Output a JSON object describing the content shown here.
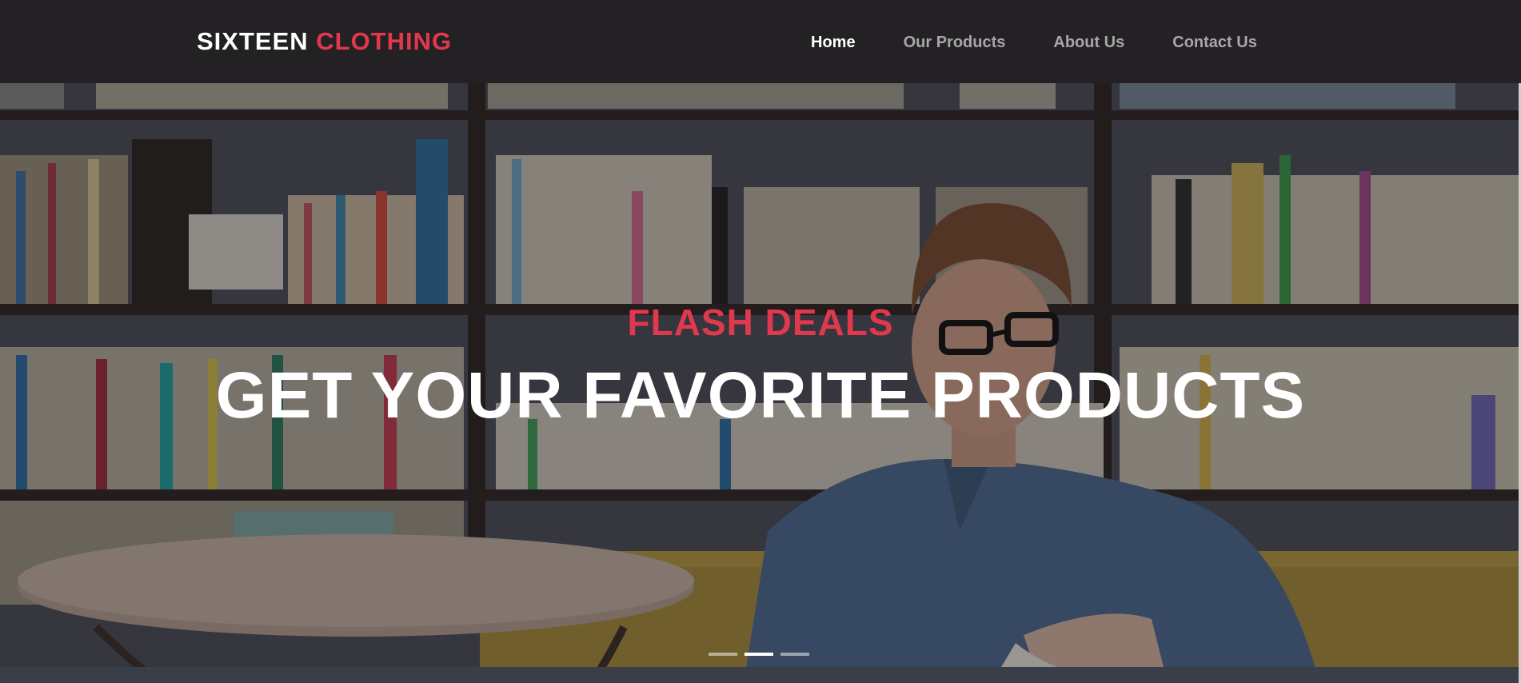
{
  "brand": {
    "first": "SIXTEEN",
    "second": "CLOTHING",
    "accent_color": "#e0384d"
  },
  "nav": {
    "items": [
      {
        "label": "Home",
        "active": true
      },
      {
        "label": "Our Products",
        "active": false
      },
      {
        "label": "About Us",
        "active": false
      },
      {
        "label": "Contact Us",
        "active": false
      }
    ]
  },
  "hero": {
    "subtitle": "FLASH DEALS",
    "title": "GET YOUR FAVORITE PRODUCTS",
    "background_description_icon": "photo-person-reading-in-library",
    "slides": 3,
    "active_slide": 2
  },
  "colors": {
    "nav_bg": "#232123",
    "accent": "#e0384d",
    "nav_text": "#a8a6a8"
  }
}
